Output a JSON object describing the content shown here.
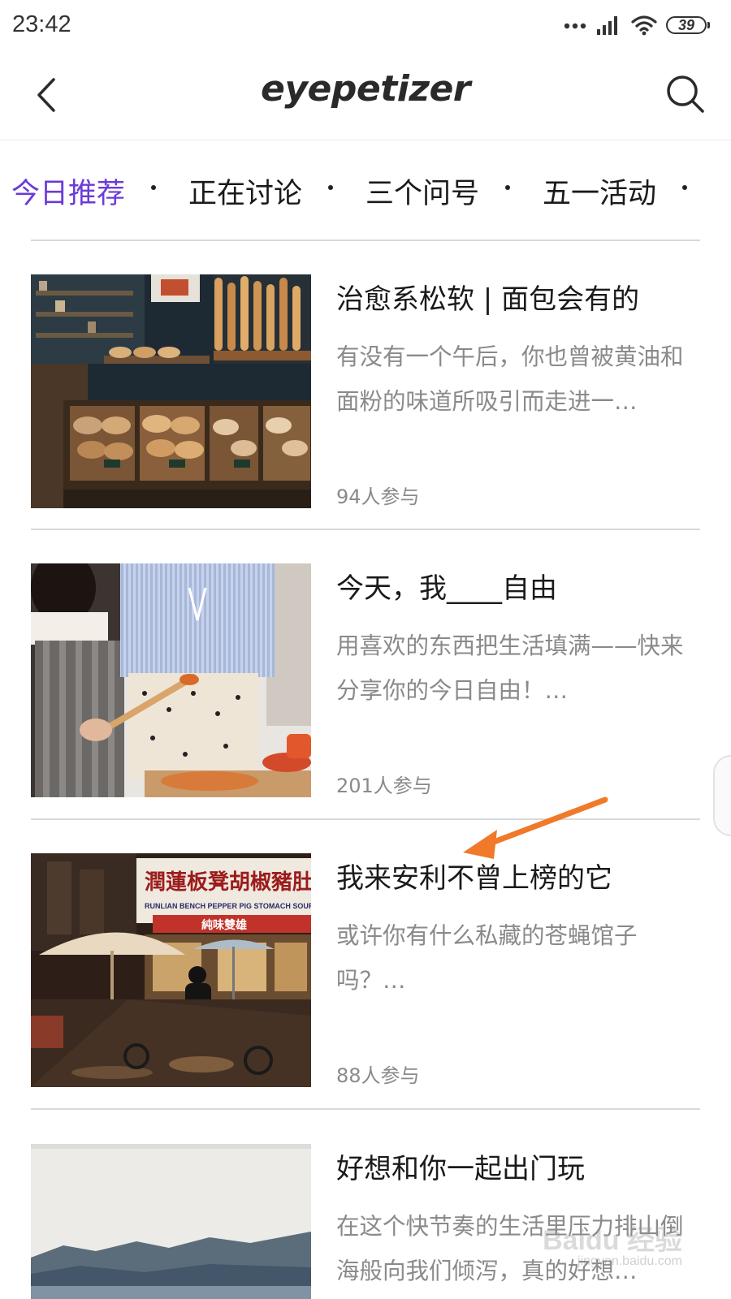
{
  "status_bar": {
    "time": "23:42",
    "battery": "39",
    "icons": [
      "more-dots-icon",
      "signal-icon",
      "wifi-icon",
      "battery-icon"
    ]
  },
  "header": {
    "logo": "eyepetizer",
    "back_icon": "chevron-left-icon",
    "search_icon": "search-icon"
  },
  "tabs": [
    {
      "label": "今日推荐",
      "active": true
    },
    {
      "label": "正在讨论",
      "active": false
    },
    {
      "label": "三个问号",
      "active": false
    },
    {
      "label": "五一活动",
      "active": false
    }
  ],
  "colors": {
    "accent": "#6a3bd8",
    "text_primary": "#1a1a1a",
    "text_secondary": "#8a8a8a",
    "divider": "#d9d9d9",
    "annotation": "#f07a2a"
  },
  "cards": [
    {
      "title": "治愈系松软 | 面包会有的",
      "desc": "有没有一个午后，你也曾被黄油和面粉的味道所吸引而走进一…",
      "count": "94人参与",
      "thumb": "bakery-photo"
    },
    {
      "title": "今天，我____自由",
      "desc": "用喜欢的东西把生活填满——快来分享你的今日自由！…",
      "count": "201人参与",
      "thumb": "cooking-photo"
    },
    {
      "title": "我来安利不曾上榜的它",
      "desc": "或许你有什么私藏的苍蝇馆子吗？…",
      "count": "88人参与",
      "thumb": "street-restaurant-photo"
    },
    {
      "title": "好想和你一起出门玩",
      "desc": "在这个快节奏的生活里压力排山倒海般向我们倾泻，真的好想…",
      "count": "",
      "thumb": "mountain-lake-photo"
    }
  ],
  "signboard": {
    "text": "潤蓮板凳胡椒豬肚湯",
    "english": "RUNLIAN BENCH PEPPER PIG STOMACH SOUP",
    "sub": "純味雙雄"
  },
  "watermark": {
    "text": "Baidu 经验",
    "sub": "jingyan.baidu.com"
  }
}
